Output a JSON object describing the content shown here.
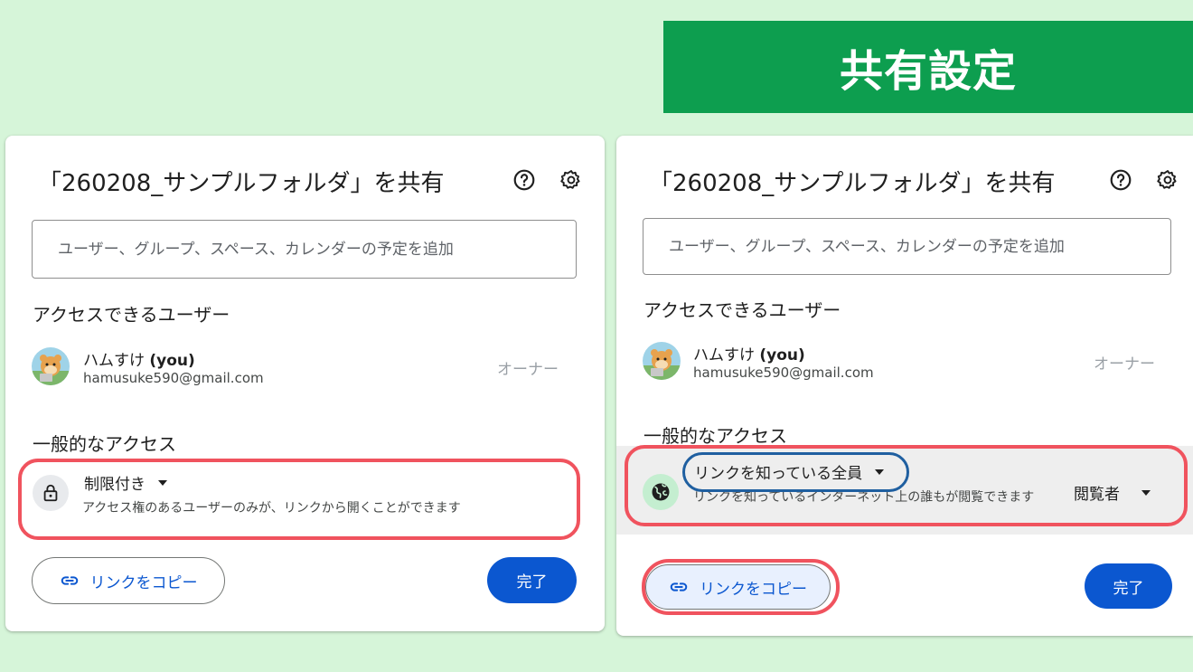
{
  "banner": {
    "title": "共有設定"
  },
  "left_dialog": {
    "title": "「260208_サンプルフォルダ」を共有",
    "search": {
      "placeholder": "ユーザー、グループ、スペース、カレンダーの予定を追加",
      "value": ""
    },
    "people_section": "アクセスできるユーザー",
    "user": {
      "name": "ハムすけ",
      "you": "(you)",
      "email": "hamusuke590@gmail.com",
      "role": "オーナー"
    },
    "general_section": "一般的なアクセス",
    "access": {
      "setting": "制限付き",
      "description": "アクセス権のあるユーザーのみが、リンクから開くことができます"
    },
    "copy_link": "リンクをコピー",
    "done": "完了"
  },
  "right_dialog": {
    "title": "「260208_サンプルフォルダ」を共有",
    "search": {
      "placeholder": "ユーザー、グループ、スペース、カレンダーの予定を追加",
      "value": ""
    },
    "people_section": "アクセスできるユーザー",
    "user": {
      "name": "ハムすけ",
      "you": "(you)",
      "email": "hamusuke590@gmail.com",
      "role": "オーナー"
    },
    "general_section": "一般的なアクセス",
    "access": {
      "setting": "リンクを知っている全員",
      "description": "リンクを知っているインターネット上の誰もが閲覧できます",
      "role": "閲覧者"
    },
    "copy_link": "リンクをコピー",
    "done": "完了"
  },
  "icons": {
    "help": "help-circle-icon",
    "settings": "gear-icon",
    "lock": "lock-icon",
    "globe": "globe-icon",
    "link": "link-icon"
  },
  "colors": {
    "background": "#d6f5d9",
    "banner": "#0d9e4f",
    "highlight_red": "#f0535e",
    "highlight_blue": "#1f5fa0",
    "primary_button": "#0b57d0"
  }
}
